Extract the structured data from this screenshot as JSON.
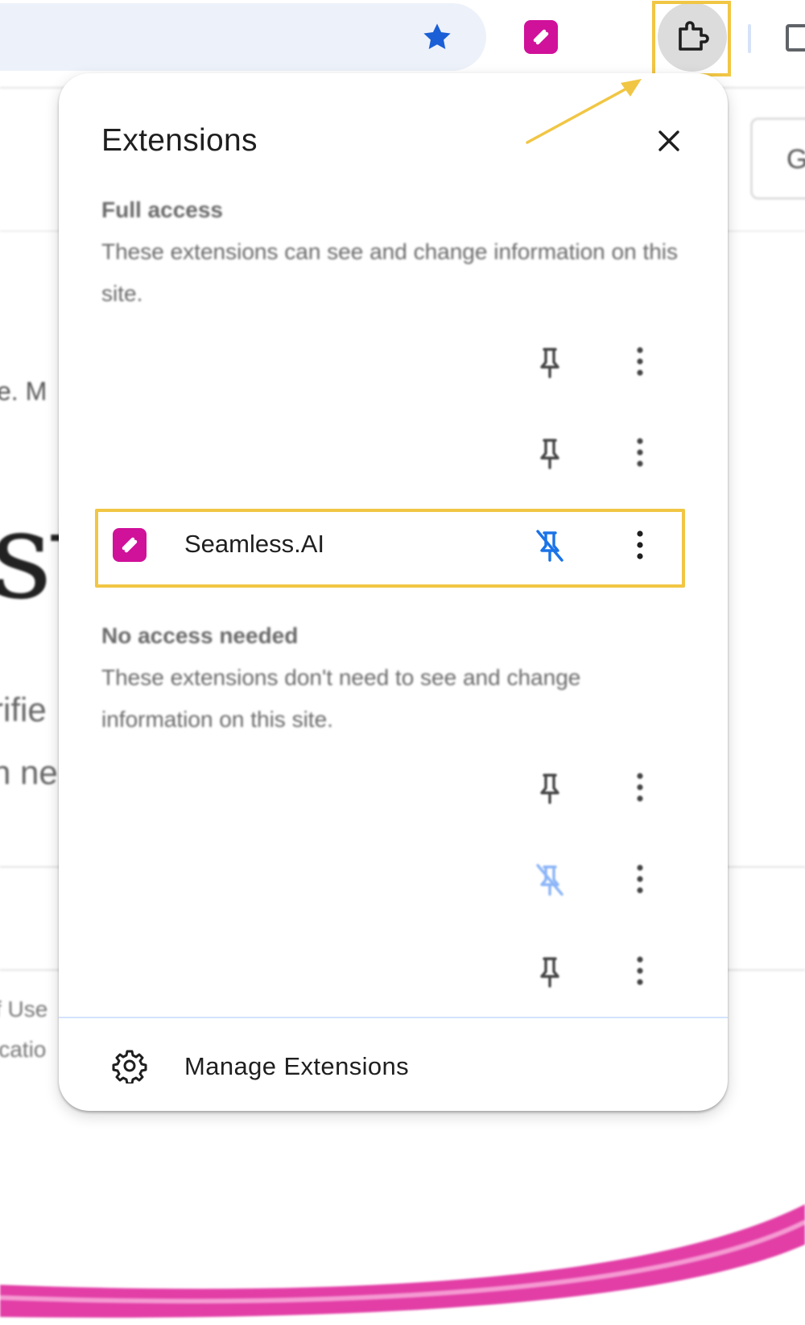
{
  "browser": {
    "toolbar_icons": [
      "star-icon",
      "seamless-ai-icon",
      "puzzle-icon",
      "window-icon"
    ]
  },
  "background_page": {
    "fragments": [
      "G",
      "e. M",
      "st",
      "rifie",
      "n ne",
      "f Use",
      "icatio"
    ]
  },
  "popup": {
    "title": "Extensions",
    "close_icon": "close-icon",
    "full_access": {
      "heading": "Full access",
      "description": "These extensions can see and change information on this site."
    },
    "no_access": {
      "heading": "No access needed",
      "description": "These extensions don't need to see and change information on this site."
    },
    "highlighted_extension": {
      "name": "Seamless.AI",
      "brand_color": "#d0119a",
      "pin_state": "unpinned-icon"
    },
    "footer": {
      "label": "Manage Extensions",
      "icon": "gear-icon"
    }
  },
  "colors": {
    "highlight": "#f1c644",
    "accent_blue": "#1a73e8",
    "brand": "#d0119a"
  }
}
